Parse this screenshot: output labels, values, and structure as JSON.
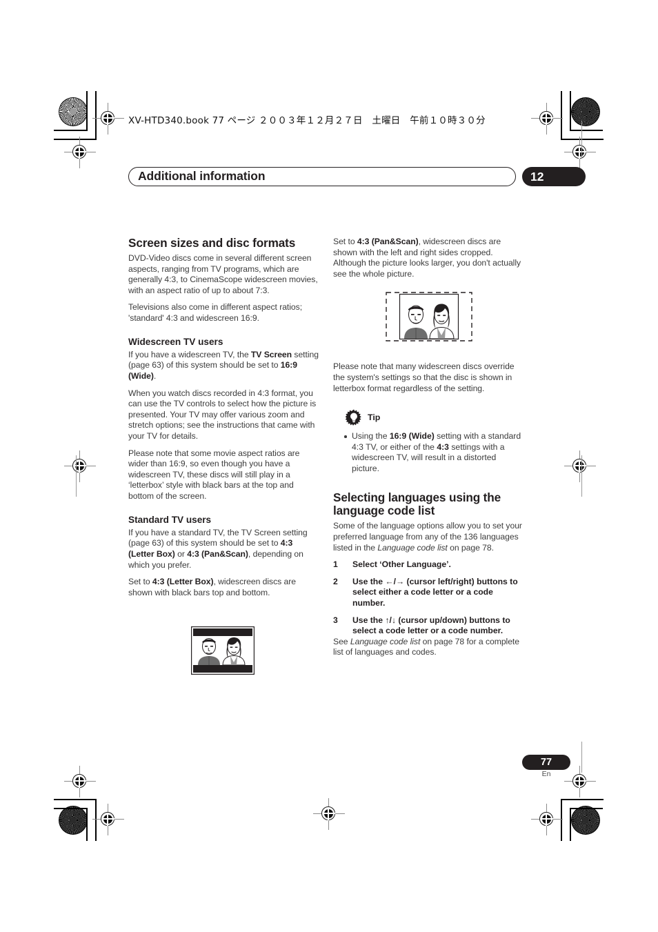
{
  "print_marks": {
    "book_line": "XV-HTD340.book  77 ページ  ２００３年１２月２７日　土曜日　午前１０時３０分"
  },
  "header": {
    "chapter_title": "Additional information",
    "chapter_number": "12"
  },
  "left_column": {
    "section_title": "Screen sizes and disc formats",
    "intro_p1": "DVD-Video discs come in several different screen aspects, ranging from TV programs, which are generally 4:3, to CinemaScope widescreen movies, with an aspect ratio of up to about 7:3.",
    "intro_p2": "Televisions also come in different aspect ratios; 'standard' 4:3 and widescreen 16:9.",
    "widescreen_heading": "Widescreen TV users",
    "widescreen_p1_a": "If you have a widescreen TV, the ",
    "widescreen_p1_b": "TV Screen",
    "widescreen_p1_c": " setting (page 63) of this system should be set to ",
    "widescreen_p1_d": "16:9 (Wide)",
    "widescreen_p1_e": ".",
    "widescreen_p2": "When you watch discs recorded in 4:3 format, you can use the TV controls to select how the picture is presented. Your TV may offer various zoom and stretch options; see the instructions that came with your TV for details.",
    "widescreen_p3": "Please note that some movie aspect ratios are wider than 16:9, so even though you have a widescreen TV, these discs will still play in a ‘letterbox’ style with black bars at the top and bottom of the screen.",
    "standard_heading": "Standard TV users",
    "standard_p1_a": "If you have a standard TV, the TV Screen setting (page 63) of this system should be set to ",
    "standard_p1_b": "4:3 (Letter Box)",
    "standard_p1_c": " or ",
    "standard_p1_d": "4:3 (Pan&Scan)",
    "standard_p1_e": ", depending on which you prefer.",
    "standard_p2_a": "Set to ",
    "standard_p2_b": "4:3 (Letter Box)",
    "standard_p2_c": ", widescreen discs are shown with black bars top and bottom.",
    "figure_letterbox_name": "letterbox-illustration"
  },
  "right_column": {
    "panscan_p_a": "Set to ",
    "panscan_p_b": "4:3 (Pan&Scan)",
    "panscan_p_c": ", widescreen discs are shown with the left and right sides cropped. Although the picture looks larger, you don't actually see the whole picture.",
    "figure_panscan_name": "pan-and-scan-illustration",
    "override_p": "Please note that many widescreen discs override the system's settings so that the disc is shown in letterbox format regardless of the setting.",
    "tip_label": "Tip",
    "tip_bullet_a": "Using the ",
    "tip_bullet_b": "16:9 (Wide)",
    "tip_bullet_c": " setting with a standard 4:3 TV, or either of the ",
    "tip_bullet_d": "4:3",
    "tip_bullet_e": " settings with a widescreen TV, will result in a distorted picture.",
    "lang_section_title": "Selecting languages using the language code list",
    "lang_intro_a": "Some of the language options allow you to set your preferred language from any of the 136 languages listed in the ",
    "lang_intro_b": "Language code list",
    "lang_intro_c": " on page 78.",
    "steps": [
      {
        "n": "1",
        "text": "Select ‘Other Language’."
      },
      {
        "n": "2",
        "text": "Use the ←/→ (cursor left/right) buttons to select either a code letter or a code number."
      },
      {
        "n": "3",
        "text": "Use the ↑/↓ (cursor up/down) buttons to select a code letter or a code number."
      }
    ],
    "step3_note_a": "See ",
    "step3_note_b": "Language code list",
    "step3_note_c": " on page 78 for a complete list of languages and codes."
  },
  "footer": {
    "page_number": "77",
    "language_code": "En"
  },
  "colors": {
    "ink": "#231f20",
    "body_text": "#3b3b3b",
    "paper": "#ffffff"
  }
}
